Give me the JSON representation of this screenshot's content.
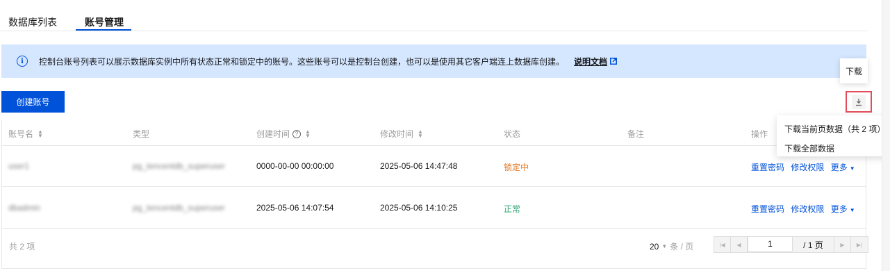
{
  "tabs": [
    {
      "label": "数据库列表",
      "active": false
    },
    {
      "label": "账号管理",
      "active": true
    }
  ],
  "notice": {
    "text": "控制台账号列表可以展示数据库实例中所有状态正常和锁定中的账号。这些账号可以是控制台创建，也可以是使用其它客户端连上数据库创建。",
    "link_label": "说明文档"
  },
  "toolbar": {
    "create_label": "创建账号",
    "download_tooltip": "下载"
  },
  "download_menu": {
    "items": [
      "下载当前页数据（共 2 项）",
      "下载全部数据"
    ]
  },
  "table": {
    "headers": {
      "name": "账号名",
      "type": "类型",
      "created": "创建时间",
      "modified": "修改时间",
      "status": "状态",
      "remark": "备注",
      "ops": "操作"
    },
    "rows": [
      {
        "name": "user1",
        "type": "pg_tencentdb_superuser",
        "created": "0000-00-00 00:00:00",
        "modified": "2025-05-06 14:47:48",
        "status": "锁定中",
        "status_kind": "locked",
        "op_reset": "重置密码",
        "op_modify": "修改权限",
        "op_more": "更多"
      },
      {
        "name": "dbadmin",
        "type": "pg_tencentdb_superuser",
        "created": "2025-05-06 14:07:54",
        "modified": "2025-05-06 14:10:25",
        "status": "正常",
        "status_kind": "normal",
        "op_reset": "重置密码",
        "op_modify": "修改权限",
        "op_more": "更多"
      }
    ]
  },
  "pagination": {
    "total_label": "共 2 项",
    "page_size": "20",
    "page_size_unit": "条 / 页",
    "current_page": "1",
    "total_pages": "/ 1 页"
  },
  "colors": {
    "primary": "#0052d9",
    "locked": "#e37318",
    "normal": "#2ba471",
    "notice_bg": "#d5e6ff"
  }
}
